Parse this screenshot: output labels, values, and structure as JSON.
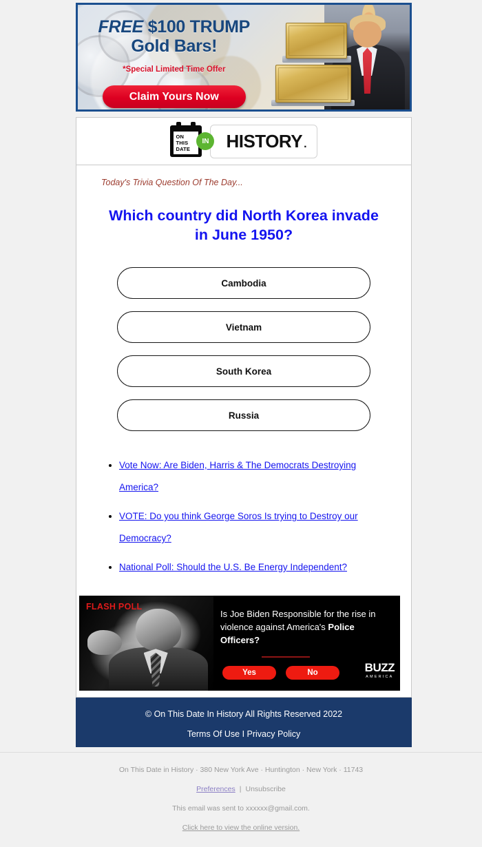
{
  "ad": {
    "headline_italic": "FREE",
    "headline_rest": " $100 TRUMP",
    "headline_line2": "Gold Bars!",
    "subtext": "*Special Limited Time Offer",
    "cta_label": "Claim Yours Now",
    "border_color": "#1b4f8f",
    "headline_color": "#18477e",
    "cta_color": "#dd0021",
    "subtext_color": "#d8112a"
  },
  "logo": {
    "calendar_line1": "ON",
    "calendar_line2": "THIS",
    "calendar_line3": "DATE",
    "in_badge": "IN",
    "history_text": "HISTORY",
    "history_dot": ".",
    "badge_color": "#5cb531"
  },
  "main": {
    "trivia_label": "Today's Trivia Question Of The Day...",
    "trivia_label_color": "#9c3b2e",
    "question": "Which country did North Korea invade in June 1950?",
    "question_color": "#1414ef",
    "answers": [
      {
        "label": "Cambodia"
      },
      {
        "label": "Vietnam"
      },
      {
        "label": "South Korea"
      },
      {
        "label": "Russia"
      }
    ],
    "links": [
      {
        "text": "Vote Now: Are Biden, Harris & The Democrats Destroying America?"
      },
      {
        "text": "VOTE: Do you think George Soros Is trying to Destroy our Democracy?"
      },
      {
        "text": "National Poll: Should the U.S. Be Energy Independent?"
      }
    ],
    "link_color": "#1414ef"
  },
  "poll": {
    "tag": "FLASH POLL",
    "tag_color": "#e01b1b",
    "question_part1": "Is Joe Biden Responsible for the rise in violence against America's ",
    "question_bold": "Police Officers?",
    "yes_label": "Yes",
    "no_label": "No",
    "button_color": "#ee1b11",
    "brand_main": "BUZZ",
    "brand_sub": "AMERICA"
  },
  "footer": {
    "copyright": "© On This Date In History All Rights Reserved 2022",
    "terms": "Terms Of Use",
    "separator": " I ",
    "privacy": "Privacy Policy",
    "background_color": "#1b3a6b"
  },
  "unsubscribe": {
    "address": "On This Date in History · 380 New York Ave · Huntington · New York · 11743",
    "preferences": "Preferences",
    "pipe": "|",
    "unsubscribe": "Unsubscribe",
    "sent_to": "This email was sent to xxxxxx@gmail.com.",
    "online_version": "Click here to view the online version."
  }
}
